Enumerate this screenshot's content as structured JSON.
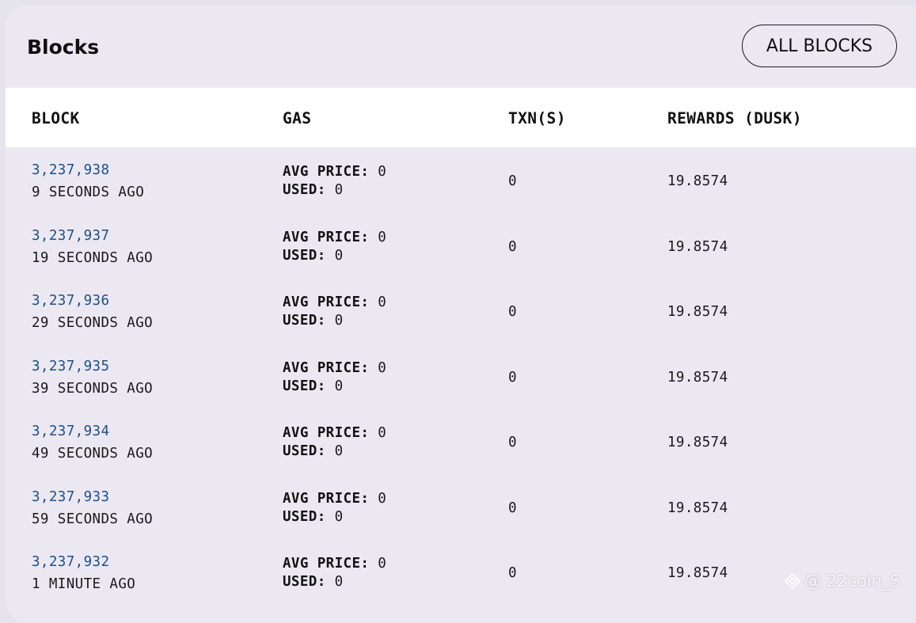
{
  "header": {
    "title": "Blocks",
    "all_blocks_label": "ALL BLOCKS"
  },
  "columns": {
    "block": "BLOCK",
    "gas": "GAS",
    "txns": "TXN(S)",
    "rewards": "REWARDS (DUSK)"
  },
  "gas_labels": {
    "avg_price": "AVG PRICE:",
    "used": "USED:"
  },
  "rows": [
    {
      "block": "3,237,938",
      "age": "9 SECONDS AGO",
      "avg_price": "0",
      "used": "0",
      "txns": "0",
      "rewards": "19.8574"
    },
    {
      "block": "3,237,937",
      "age": "19 SECONDS AGO",
      "avg_price": "0",
      "used": "0",
      "txns": "0",
      "rewards": "19.8574"
    },
    {
      "block": "3,237,936",
      "age": "29 SECONDS AGO",
      "avg_price": "0",
      "used": "0",
      "txns": "0",
      "rewards": "19.8574"
    },
    {
      "block": "3,237,935",
      "age": "39 SECONDS AGO",
      "avg_price": "0",
      "used": "0",
      "txns": "0",
      "rewards": "19.8574"
    },
    {
      "block": "3,237,934",
      "age": "49 SECONDS AGO",
      "avg_price": "0",
      "used": "0",
      "txns": "0",
      "rewards": "19.8574"
    },
    {
      "block": "3,237,933",
      "age": "59 SECONDS AGO",
      "avg_price": "0",
      "used": "0",
      "txns": "0",
      "rewards": "19.8574"
    },
    {
      "block": "3,237,932",
      "age": "1 MINUTE AGO",
      "avg_price": "0",
      "used": "0",
      "txns": "0",
      "rewards": "19.8574"
    }
  ],
  "watermark": {
    "text": "@ 22coin_S",
    "icon": "diamond-logo-icon"
  },
  "colors": {
    "card_bg": "#ebe8f2",
    "header_row_bg": "#ffffff",
    "link": "#1e4f86",
    "text": "#1a1a1a"
  }
}
